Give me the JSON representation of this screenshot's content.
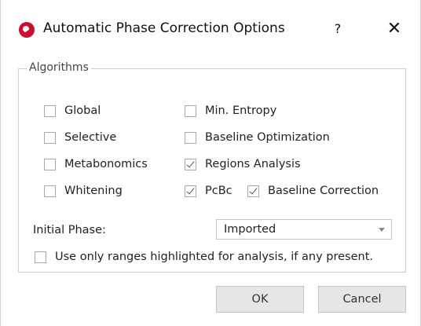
{
  "window": {
    "title": "Automatic Phase Correction Options",
    "help_label": "?",
    "close_label": "✕",
    "icon": "app-logo-icon"
  },
  "algorithms": {
    "legend": "Algorithms",
    "options": [
      {
        "label": "Global",
        "checked": false
      },
      {
        "label": "Selective",
        "checked": false
      },
      {
        "label": "Metabonomics",
        "checked": false
      },
      {
        "label": "Whitening",
        "checked": false
      },
      {
        "label": "Min. Entropy",
        "checked": false
      },
      {
        "label": "Baseline Optimization",
        "checked": false
      },
      {
        "label": "Regions Analysis",
        "checked": true
      },
      {
        "label": "PcBc",
        "checked": true
      },
      {
        "label": "Baseline Correction",
        "checked": true
      }
    ],
    "initial_phase_label": "Initial Phase:",
    "initial_phase_value": "Imported",
    "highlight_option": {
      "label": "Use only ranges highlighted for analysis, if any present.",
      "checked": false
    }
  },
  "buttons": {
    "ok_label": "OK",
    "cancel_label": "Cancel"
  }
}
